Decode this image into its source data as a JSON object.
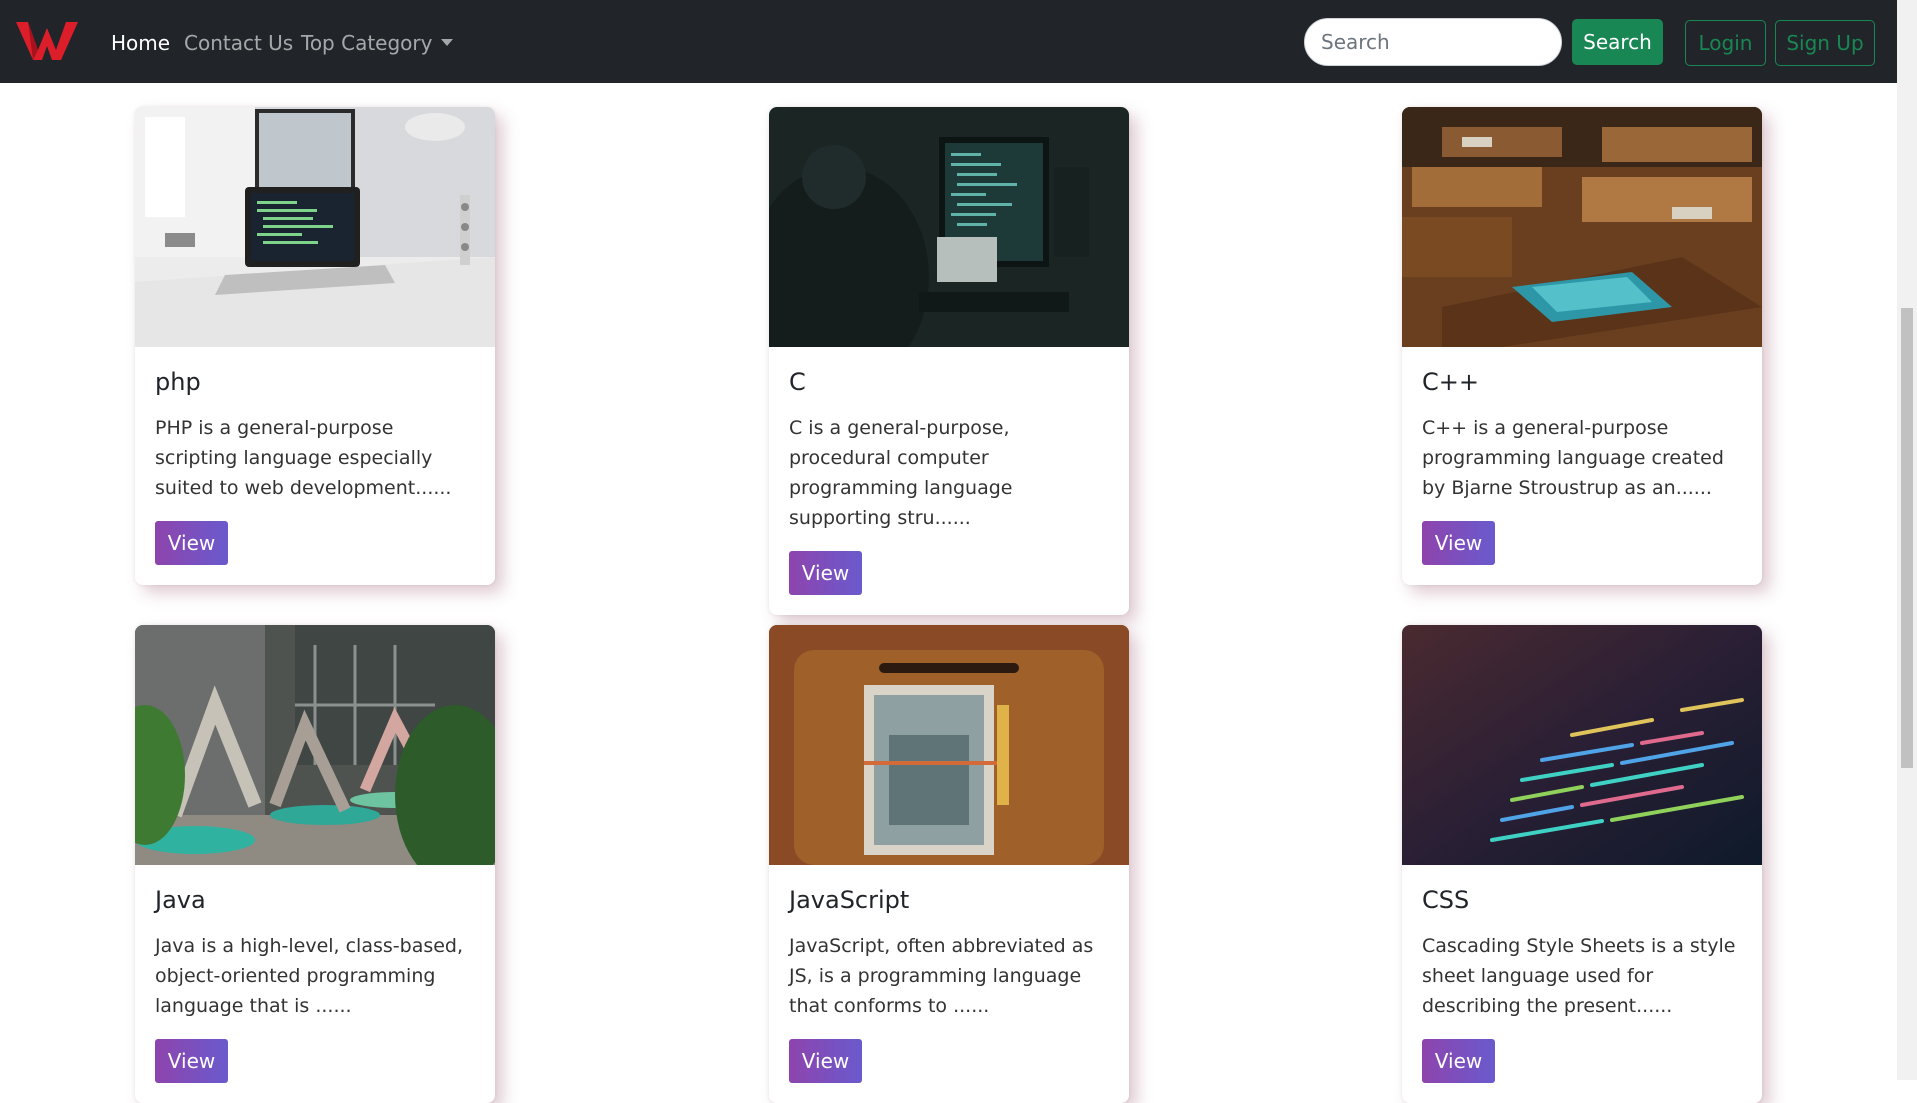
{
  "nav": {
    "brand_color": "#dc1e2a",
    "links": [
      "Home",
      "Contact Us",
      "Top Category"
    ],
    "search_placeholder": "Search",
    "search_button": "Search",
    "login": "Login",
    "signup": "Sign Up"
  },
  "cards": [
    {
      "title": "php",
      "text": "PHP is a general-purpose scripting language especially suited to web development......",
      "button": "View"
    },
    {
      "title": "C",
      "text": "C is a general-purpose, procedural computer programming language supporting stru......",
      "button": "View"
    },
    {
      "title": "C++",
      "text": "C++ is a general-purpose programming language created by Bjarne Stroustrup as an......",
      "button": "View"
    },
    {
      "title": "Java",
      "text": "Java is a high-level, class-based, object-oriented programming language that is ......",
      "button": "View"
    },
    {
      "title": "JavaScript",
      "text": "JavaScript, often abbreviated as JS, is a programming language that conforms to ......",
      "button": "View"
    },
    {
      "title": "CSS",
      "text": "Cascading Style Sheets is a style sheet language used for describing the present......",
      "button": "View"
    }
  ]
}
